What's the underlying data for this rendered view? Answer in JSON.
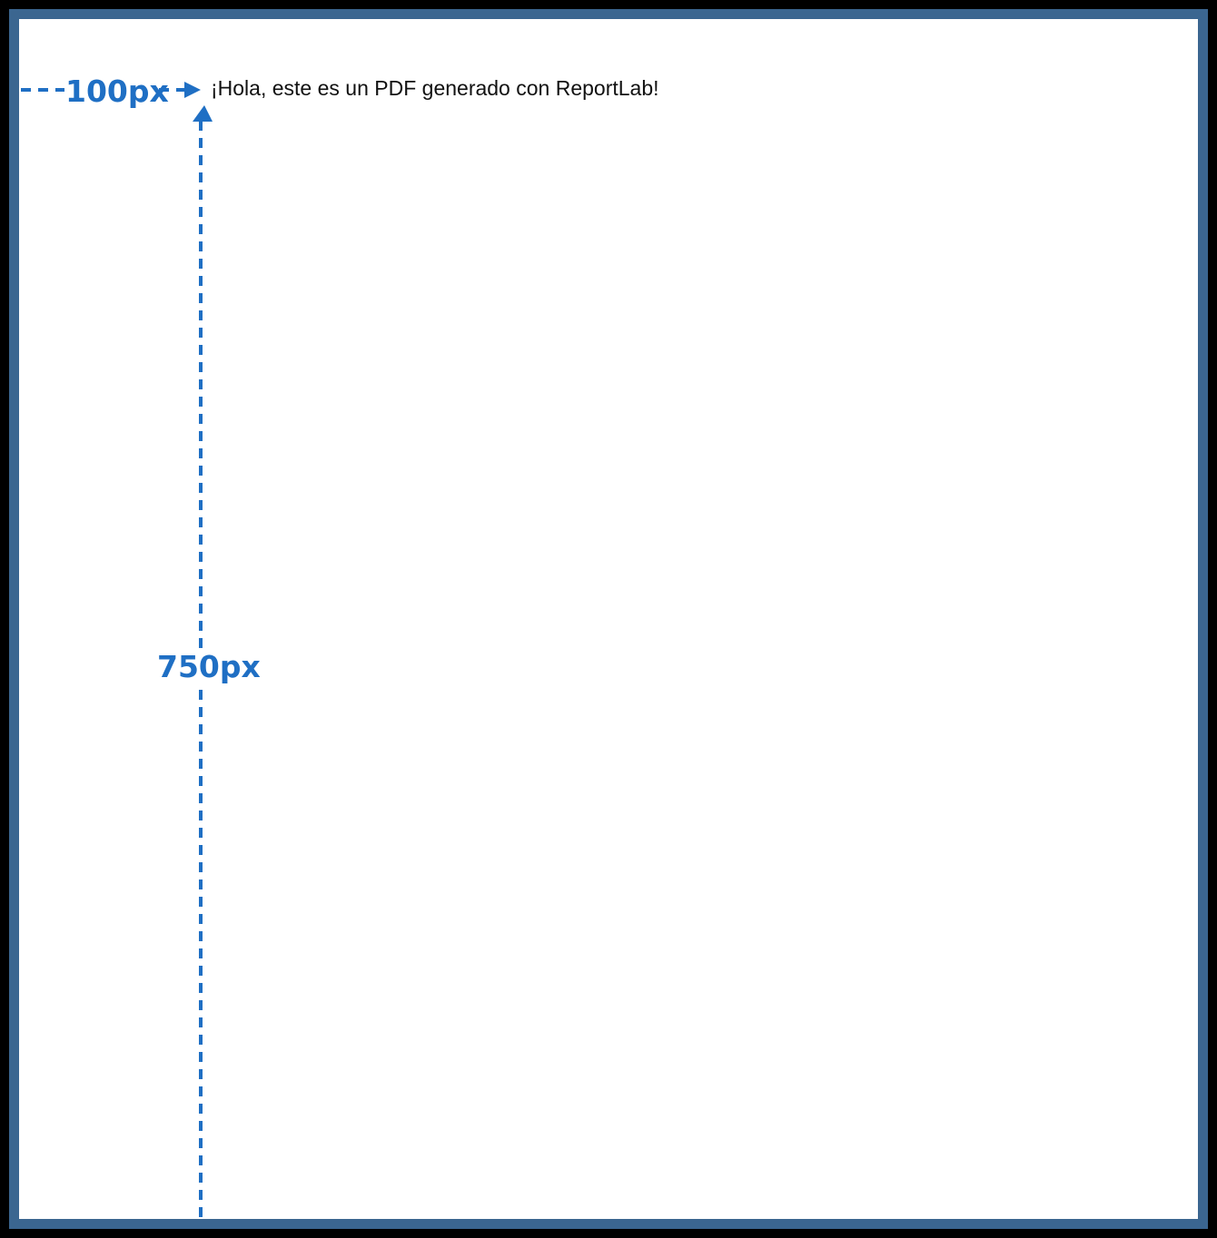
{
  "document": {
    "text": "¡Hola, este es un PDF generado con ReportLab!"
  },
  "annotations": {
    "color": "#1f6fc4",
    "horizontal_label": "100px",
    "vertical_label": "750px"
  }
}
